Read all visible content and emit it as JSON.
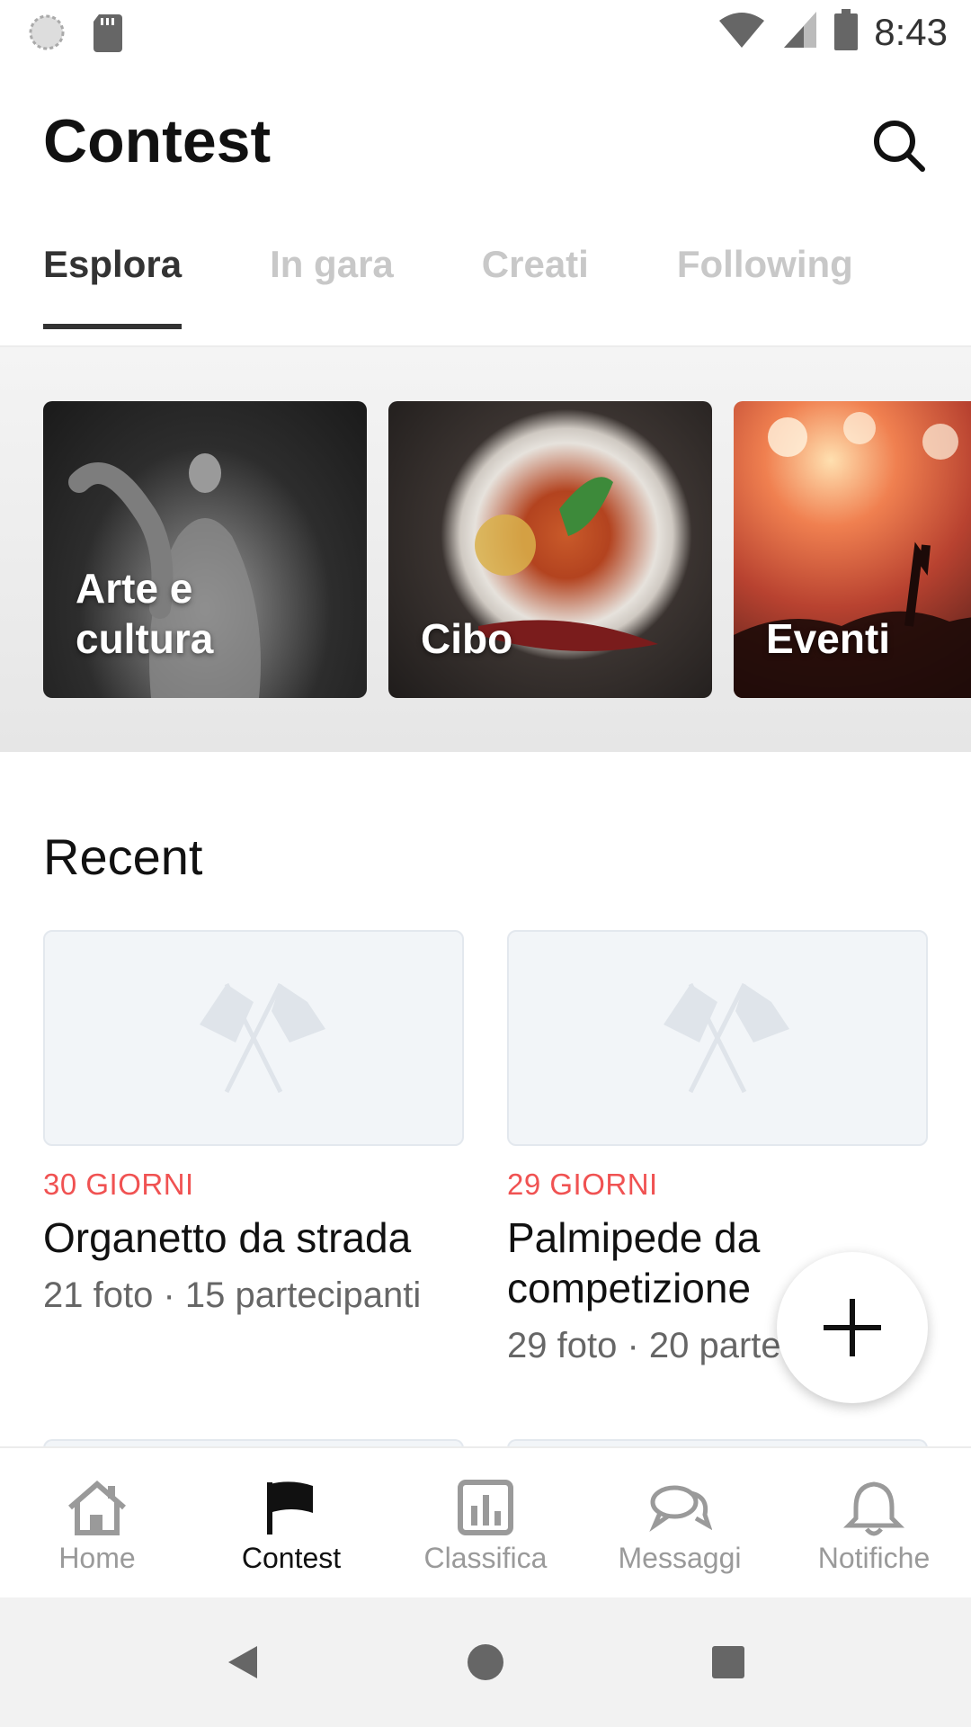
{
  "status_bar": {
    "time": "8:43",
    "icons": [
      "loading-icon",
      "sd-card-icon",
      "wifi-icon",
      "signal-icon",
      "battery-icon"
    ]
  },
  "header": {
    "title": "Contest",
    "search_icon": "search-icon"
  },
  "tabs": [
    {
      "label": "Esplora",
      "active": true
    },
    {
      "label": "In gara",
      "active": false
    },
    {
      "label": "Creati",
      "active": false
    },
    {
      "label": "Following",
      "active": false
    }
  ],
  "categories": [
    {
      "label": "Arte e cultura"
    },
    {
      "label": "Cibo"
    },
    {
      "label": "Eventi"
    }
  ],
  "recent": {
    "title": "Recent",
    "cards": [
      {
        "days": "30 GIORNI",
        "title": "Organetto da strada",
        "meta": "21 foto · 15 partecipanti"
      },
      {
        "days": "29 GIORNI",
        "title": "Palmipede da competizione",
        "meta": "29 foto · 20 partecipanti"
      }
    ]
  },
  "fab": {
    "icon": "plus-icon"
  },
  "bottom_nav": [
    {
      "label": "Home",
      "icon": "home-icon",
      "active": false
    },
    {
      "label": "Contest",
      "icon": "flag-icon",
      "active": true
    },
    {
      "label": "Classifica",
      "icon": "chart-icon",
      "active": false
    },
    {
      "label": "Messaggi",
      "icon": "chat-icon",
      "active": false
    },
    {
      "label": "Notifiche",
      "icon": "bell-icon",
      "active": false
    }
  ],
  "colors": {
    "accent_days": "#f05252",
    "active_text": "#333333",
    "inactive_text": "#c8c8c8"
  }
}
